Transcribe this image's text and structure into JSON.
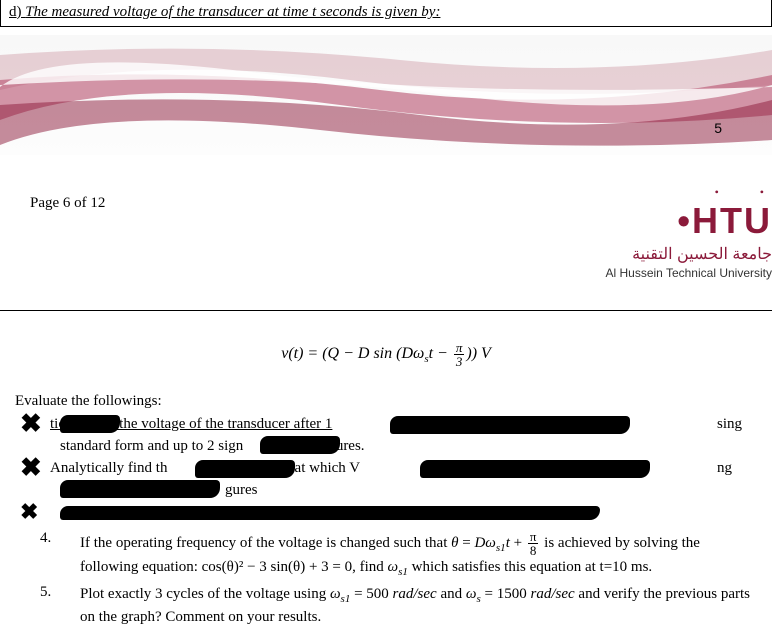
{
  "top_question": {
    "label": "d)",
    "text": "The measured voltage of the transducer at time t seconds is given by:"
  },
  "banner_page_num": "5",
  "page_label": "Page 6 of 12",
  "logo": {
    "main": "HTU",
    "arabic": "جامعة الحسين التقنية",
    "english": "Al Hussein Technical University"
  },
  "formula": "v(t) = (Q − D sin (Dωₛt − π/3)) V",
  "evaluate_heading": "Evaluate the followings:",
  "redacted": {
    "line1_partial": "tically find the voltage of the transducer after 1",
    "line1_right": "sing",
    "line2_left": "standard form and up to 2 sign",
    "line2_mid": "gures.",
    "line3_left": "Analytically find th",
    "line3_mid": "me at which V",
    "line3_right": "ng",
    "line4_mid": "gures"
  },
  "items": {
    "item4_num": "4.",
    "item4_text_a": "If the operating frequency of the voltage is changed such that ",
    "item4_math_a": "θ = Dωₛ₁t + ",
    "item4_text_b": " is achieved by solving the following equation: cos(θ)² − 3 sin(θ) + 3 = 0, find ",
    "item4_math_b": "ωₛ₁",
    "item4_text_c": " which satisfies this equation at t=10 ms.",
    "item5_num": "5.",
    "item5_text_a": "Plot exactly 3 cycles of the voltage using ",
    "item5_math_a": "ωₛ₁ = 500 rad/sec",
    "item5_text_b": " and ",
    "item5_math_b": "ωₛ = 1500 rad/sec",
    "item5_text_c": " and verify the previous parts on the graph? Comment on your results."
  }
}
